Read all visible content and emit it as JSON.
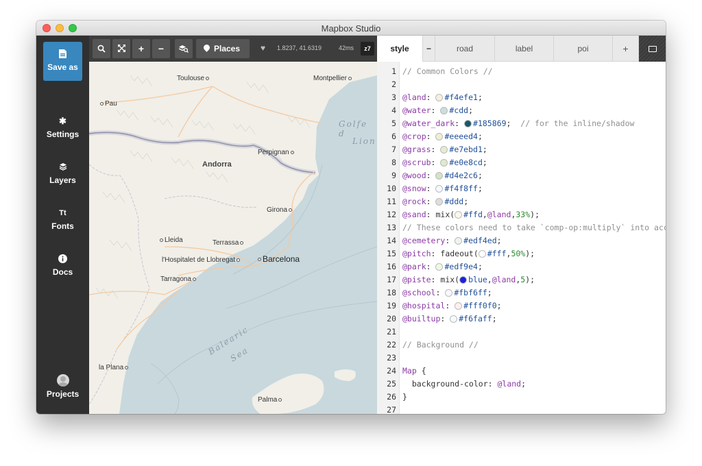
{
  "window": {
    "title": "Mapbox Studio"
  },
  "sidebar": {
    "items": [
      {
        "label": "Save as",
        "icon": "save-icon"
      },
      {
        "label": "Settings",
        "icon": "gear-icon"
      },
      {
        "label": "Layers",
        "icon": "layers-icon"
      },
      {
        "label": "Fonts",
        "icon": "fonts-icon"
      },
      {
        "label": "Docs",
        "icon": "info-icon"
      },
      {
        "label": "Projects",
        "icon": "avatar-icon"
      }
    ],
    "accent": "#3887be"
  },
  "map": {
    "toolbar": {
      "zoom_in": "+",
      "zoom_out": "−",
      "places_label": "Places",
      "coords": "1.8237, 41.6319",
      "render_time": "42ms",
      "zoom_level": "z7"
    },
    "labels": {
      "toulouse": "Toulouse",
      "montpellier": "Montpellier",
      "pau": "Pau",
      "andorra": "Andorra",
      "perpignan": "Perpignan",
      "girona": "Girona",
      "lleida": "Lleida",
      "terrassa": "Terrassa",
      "hospitalet": "l'Hospitalet de Llobregat",
      "barcelona": "Barcelona",
      "tarragona": "Tarragona",
      "la_plana": "la Plana",
      "palma": "Palma",
      "golfe": "Golfe d",
      "lion": "Lion",
      "balearic": "Balearic",
      "sea": "Sea"
    },
    "colors": {
      "land": "#f1efe8",
      "water": "#c8d8dd",
      "border": "#8a8aa8",
      "road": "#f5c9a0"
    }
  },
  "editor": {
    "tabs": [
      "style",
      "−",
      "road",
      "label",
      "poi",
      "+"
    ],
    "lines": [
      {
        "n": "1",
        "parts": [
          {
            "t": "// Common Colors //",
            "c": "com"
          }
        ]
      },
      {
        "n": "2",
        "parts": []
      },
      {
        "n": "3",
        "parts": [
          {
            "t": "@land",
            "c": "var"
          },
          {
            "t": ": "
          },
          {
            "sw": "#f4efe1"
          },
          {
            "t": "#f4efe1",
            "c": "val"
          },
          {
            "t": ";"
          }
        ]
      },
      {
        "n": "4",
        "parts": [
          {
            "t": "@water",
            "c": "var"
          },
          {
            "t": ": "
          },
          {
            "sw": "#ccdddd"
          },
          {
            "t": "#cdd",
            "c": "val"
          },
          {
            "t": ";"
          }
        ]
      },
      {
        "n": "5",
        "parts": [
          {
            "t": "@water_dark",
            "c": "var"
          },
          {
            "t": ": "
          },
          {
            "sw": "#185869"
          },
          {
            "t": "#185869",
            "c": "val"
          },
          {
            "t": ";  "
          },
          {
            "t": "// for the inline/shadow",
            "c": "com"
          }
        ]
      },
      {
        "n": "6",
        "parts": [
          {
            "t": "@crop",
            "c": "var"
          },
          {
            "t": ": "
          },
          {
            "sw": "#eeeed4"
          },
          {
            "t": "#eeeed4",
            "c": "val"
          },
          {
            "t": ";"
          }
        ]
      },
      {
        "n": "7",
        "parts": [
          {
            "t": "@grass",
            "c": "var"
          },
          {
            "t": ": "
          },
          {
            "sw": "#e7ebd1"
          },
          {
            "t": "#e7ebd1",
            "c": "val"
          },
          {
            "t": ";"
          }
        ]
      },
      {
        "n": "8",
        "parts": [
          {
            "t": "@scrub",
            "c": "var"
          },
          {
            "t": ": "
          },
          {
            "sw": "#e0e8cd"
          },
          {
            "t": "#e0e8cd",
            "c": "val"
          },
          {
            "t": ";"
          }
        ]
      },
      {
        "n": "9",
        "parts": [
          {
            "t": "@wood",
            "c": "var"
          },
          {
            "t": ": "
          },
          {
            "sw": "#d4e2c6"
          },
          {
            "t": "#d4e2c6",
            "c": "val"
          },
          {
            "t": ";"
          }
        ]
      },
      {
        "n": "10",
        "parts": [
          {
            "t": "@snow",
            "c": "var"
          },
          {
            "t": ": "
          },
          {
            "sw": "#f4f8ff"
          },
          {
            "t": "#f4f8ff",
            "c": "val"
          },
          {
            "t": ";"
          }
        ]
      },
      {
        "n": "11",
        "parts": [
          {
            "t": "@rock",
            "c": "var"
          },
          {
            "t": ": "
          },
          {
            "sw": "#dddddd"
          },
          {
            "t": "#ddd",
            "c": "val"
          },
          {
            "t": ";"
          }
        ]
      },
      {
        "n": "12",
        "parts": [
          {
            "t": "@sand",
            "c": "var"
          },
          {
            "t": ": mix("
          },
          {
            "sw": "#fbf7ea"
          },
          {
            "t": "#ffd",
            "c": "val"
          },
          {
            "t": ","
          },
          {
            "t": "@land",
            "c": "var"
          },
          {
            "t": ","
          },
          {
            "t": "33%",
            "c": "num"
          },
          {
            "t": ");"
          }
        ]
      },
      {
        "n": "13",
        "parts": [
          {
            "t": "// These colors need to take `comp-op:multiply` into acc",
            "c": "com"
          }
        ]
      },
      {
        "n": "14",
        "parts": [
          {
            "t": "@cemetery",
            "c": "var"
          },
          {
            "t": ": "
          },
          {
            "sw": "#edf4ed"
          },
          {
            "t": "#edf4ed",
            "c": "val"
          },
          {
            "t": ";"
          }
        ]
      },
      {
        "n": "15",
        "parts": [
          {
            "t": "@pitch",
            "c": "var"
          },
          {
            "t": ": fadeout("
          },
          {
            "sw": "#ffffff"
          },
          {
            "t": "#fff",
            "c": "val"
          },
          {
            "t": ","
          },
          {
            "t": "50%",
            "c": "num"
          },
          {
            "t": ");"
          }
        ]
      },
      {
        "n": "16",
        "parts": [
          {
            "t": "@park",
            "c": "var"
          },
          {
            "t": ": "
          },
          {
            "sw": "#edf9e4"
          },
          {
            "t": "#edf9e4",
            "c": "val"
          },
          {
            "t": ";"
          }
        ]
      },
      {
        "n": "17",
        "parts": [
          {
            "t": "@piste",
            "c": "var"
          },
          {
            "t": ": mix("
          },
          {
            "sw": "#1a22e0"
          },
          {
            "t": "blue",
            "c": "val"
          },
          {
            "t": ","
          },
          {
            "t": "@land",
            "c": "var"
          },
          {
            "t": ","
          },
          {
            "t": "5",
            "c": "num"
          },
          {
            "t": ");"
          }
        ]
      },
      {
        "n": "18",
        "parts": [
          {
            "t": "@school",
            "c": "var"
          },
          {
            "t": ": "
          },
          {
            "sw": "#fbf6ff"
          },
          {
            "t": "#fbf6ff",
            "c": "val"
          },
          {
            "t": ";"
          }
        ]
      },
      {
        "n": "19",
        "parts": [
          {
            "t": "@hospital",
            "c": "var"
          },
          {
            "t": ": "
          },
          {
            "sw": "#fff0f0"
          },
          {
            "t": "#fff0f0",
            "c": "val"
          },
          {
            "t": ";"
          }
        ]
      },
      {
        "n": "20",
        "parts": [
          {
            "t": "@builtup",
            "c": "var"
          },
          {
            "t": ": "
          },
          {
            "sw": "#f6faff"
          },
          {
            "t": "#f6faff",
            "c": "val"
          },
          {
            "t": ";"
          }
        ]
      },
      {
        "n": "21",
        "parts": []
      },
      {
        "n": "22",
        "parts": [
          {
            "t": "// Background //",
            "c": "com"
          }
        ]
      },
      {
        "n": "23",
        "parts": []
      },
      {
        "n": "24",
        "parts": [
          {
            "t": "Map",
            "c": "var"
          },
          {
            "t": " {"
          }
        ]
      },
      {
        "n": "25",
        "parts": [
          {
            "t": "  background-color: "
          },
          {
            "t": "@land",
            "c": "var"
          },
          {
            "t": ";"
          }
        ]
      },
      {
        "n": "26",
        "parts": [
          {
            "t": "}"
          }
        ]
      },
      {
        "n": "27",
        "parts": []
      }
    ]
  }
}
